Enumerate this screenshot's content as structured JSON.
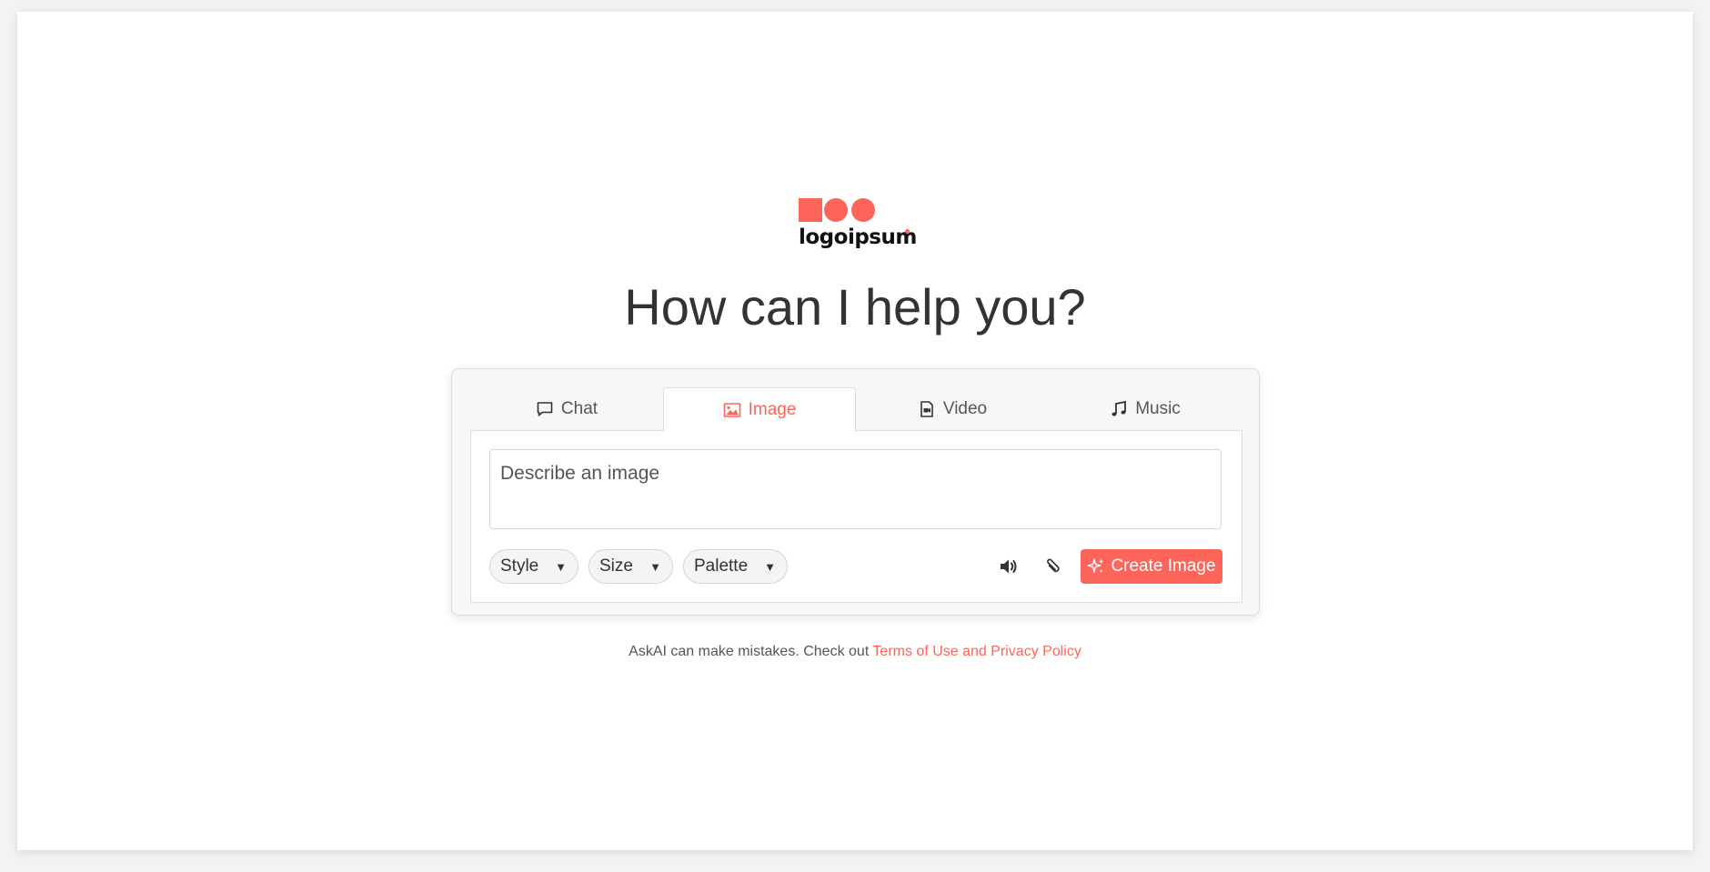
{
  "brand": {
    "name": "logoipsum",
    "accent": "#fd645a"
  },
  "headline": "How can I help you?",
  "tabs": [
    {
      "label": "Chat",
      "icon": "chat-bubble-icon"
    },
    {
      "label": "Image",
      "icon": "image-icon",
      "active": true
    },
    {
      "label": "Video",
      "icon": "video-file-icon"
    },
    {
      "label": "Music",
      "icon": "music-note-icon"
    }
  ],
  "prompt": {
    "placeholder": "Describe an image",
    "value": ""
  },
  "options": {
    "style_label": "Style",
    "size_label": "Size",
    "palette_label": "Palette"
  },
  "actions": {
    "speaker_icon": "speaker-icon",
    "attach_icon": "paperclip-icon",
    "create_label": "Create Image"
  },
  "footer": {
    "text": "AskAI can make mistakes. Check out ",
    "link_text": "Terms of Use and Privacy Policy"
  }
}
